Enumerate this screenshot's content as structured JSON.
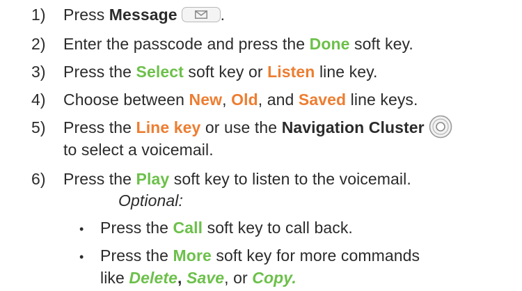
{
  "steps": [
    {
      "num": "1)",
      "a": "Press ",
      "b": "Message",
      "c": "."
    },
    {
      "num": "2)",
      "a": "Enter the passcode and press the ",
      "b": "Done",
      "c": " soft key."
    },
    {
      "num": "3)",
      "a": "Press the ",
      "b": "Select",
      "c": " soft key or ",
      "d": "Listen",
      "e": " line key."
    },
    {
      "num": "4)",
      "a": "Choose between ",
      "b": "New",
      "c": ", ",
      "d": "Old",
      "e": ", and ",
      "f": "Saved",
      "g": " line keys."
    },
    {
      "num": "5)",
      "a": "Press the ",
      "b": "Line key",
      "c": " or use the ",
      "d": "Navigation Cluster",
      "e": "to select a voicemail."
    },
    {
      "num": "6)",
      "a": "Press the ",
      "b": "Play",
      "c": " soft key to listen to the voicemail."
    }
  ],
  "optional_label": "Optional:",
  "bullets": [
    {
      "a": "Press the ",
      "b": "Call",
      "c": " soft key to call back."
    },
    {
      "a": "Press the ",
      "b": "More",
      "c": " soft key for more commands",
      "d": "like ",
      "e": "Delete",
      "f": ", ",
      "g": "Save",
      "h": ", or ",
      "i": "Copy."
    }
  ],
  "bullet_glyph": "•",
  "icons": {
    "message_key": "envelope-icon",
    "navigation_cluster": "navigation-cluster-icon"
  },
  "colors": {
    "green": "#6cc04a",
    "orange": "#ed7d31",
    "text": "#2b2b2b"
  }
}
